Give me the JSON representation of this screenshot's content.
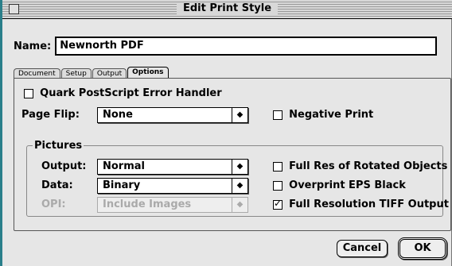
{
  "window": {
    "title": "Edit Print Style"
  },
  "name": {
    "label": "Name:",
    "value": "Newnorth PDF"
  },
  "tabs": [
    {
      "label": "Document",
      "active": false
    },
    {
      "label": "Setup",
      "active": false
    },
    {
      "label": "Output",
      "active": false
    },
    {
      "label": "Options",
      "active": true
    }
  ],
  "options": {
    "quark_handler": {
      "label": "Quark PostScript Error Handler",
      "checked": false
    },
    "page_flip": {
      "label": "Page Flip:",
      "value": "None"
    },
    "negative_print": {
      "label": "Negative Print",
      "checked": false
    }
  },
  "pictures": {
    "group_label": "Pictures",
    "output": {
      "label": "Output:",
      "value": "Normal"
    },
    "data": {
      "label": "Data:",
      "value": "Binary"
    },
    "opi": {
      "label": "OPI:",
      "value": "Include Images",
      "disabled": true
    },
    "full_res_rotated": {
      "label": "Full Res of Rotated Objects",
      "checked": false
    },
    "overprint_eps": {
      "label": "Overprint EPS Black",
      "checked": false
    },
    "full_res_tiff": {
      "label": "Full Resolution TIFF Output",
      "checked": true
    }
  },
  "buttons": {
    "cancel": "Cancel",
    "ok": "OK"
  },
  "icons": {
    "popup_arrow": "updown-arrows-icon",
    "check": "checkmark-icon"
  }
}
